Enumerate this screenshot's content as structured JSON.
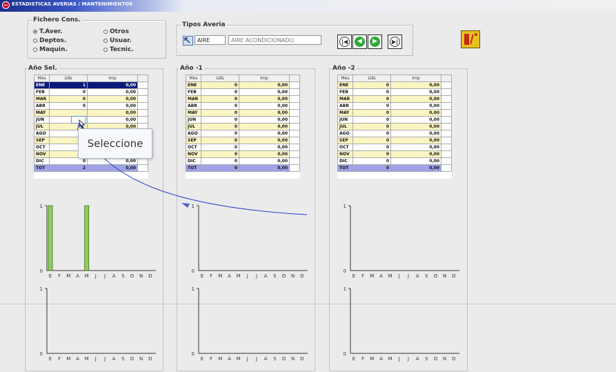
{
  "window": {
    "title": "ESTADISTICAS AVERIAS / MANTENIMIENTOS"
  },
  "fichero": {
    "label": "Fichero Cons.",
    "options": [
      {
        "label": "T.Aver.",
        "selected": true
      },
      {
        "label": "Deptos.",
        "selected": false
      },
      {
        "label": "Maquin.",
        "selected": false
      },
      {
        "label": "Otros",
        "selected": false
      },
      {
        "label": "Usuar.",
        "selected": false
      },
      {
        "label": "Tecnic.",
        "selected": false
      }
    ]
  },
  "tipos": {
    "label": "Tipos Averia",
    "code": "AIRE",
    "description": "AIRE ACONDICIONADO",
    "nav": [
      "first",
      "prev",
      "next",
      "last"
    ]
  },
  "panels": [
    {
      "label": "Año Sel.",
      "headers": [
        "Mes",
        "Uds",
        "Imp"
      ],
      "rows": [
        [
          "ENE",
          "1",
          "0,00"
        ],
        [
          "FEB",
          "0",
          "0,00"
        ],
        [
          "MAR",
          "0",
          "0,00"
        ],
        [
          "ABR",
          "0",
          "0,00"
        ],
        [
          "MAY",
          "",
          "0,00"
        ],
        [
          "JUN",
          "",
          "0,00"
        ],
        [
          "JUL",
          "",
          "0,00"
        ],
        [
          "AGO",
          "",
          "0,00"
        ],
        [
          "SEP",
          "",
          "0,00"
        ],
        [
          "OCT",
          "0",
          "0,00"
        ],
        [
          "NOV",
          "0",
          "0,00"
        ],
        [
          "DIC",
          "0",
          "0,00"
        ],
        [
          "TOT",
          "2",
          "0,00"
        ]
      ]
    },
    {
      "label": "Año -1",
      "headers": [
        "Mes",
        "Uds",
        "Imp"
      ],
      "rows": [
        [
          "ENE",
          "0",
          "0,00"
        ],
        [
          "FEB",
          "0",
          "0,00"
        ],
        [
          "MAR",
          "0",
          "0,00"
        ],
        [
          "ABR",
          "0",
          "0,00"
        ],
        [
          "MAY",
          "0",
          "0,00"
        ],
        [
          "JUN",
          "0",
          "0,00"
        ],
        [
          "JUL",
          "0",
          "0,00"
        ],
        [
          "AGO",
          "0",
          "0,00"
        ],
        [
          "SEP",
          "0",
          "0,00"
        ],
        [
          "OCT",
          "0",
          "0,00"
        ],
        [
          "NOV",
          "0",
          "0,00"
        ],
        [
          "DIC",
          "0",
          "0,00"
        ],
        [
          "TOT",
          "0",
          "0,00"
        ]
      ]
    },
    {
      "label": "Año -2",
      "headers": [
        "Mes",
        "Uds",
        "Imp"
      ],
      "rows": [
        [
          "ENE",
          "0",
          "0,00"
        ],
        [
          "FEB",
          "0",
          "0,00"
        ],
        [
          "MAR",
          "0",
          "0,00"
        ],
        [
          "ABR",
          "0",
          "0,00"
        ],
        [
          "MAY",
          "0",
          "0,00"
        ],
        [
          "JUN",
          "0",
          "0,00"
        ],
        [
          "JUL",
          "0",
          "0,00"
        ],
        [
          "AGO",
          "0",
          "0,00"
        ],
        [
          "SEP",
          "0",
          "0,00"
        ],
        [
          "OCT",
          "0",
          "0,00"
        ],
        [
          "NOV",
          "0",
          "0,00"
        ],
        [
          "DIC",
          "0",
          "0,00"
        ],
        [
          "TOT",
          "0",
          "0,00"
        ]
      ]
    }
  ],
  "chart_data": [
    {
      "type": "bar",
      "panel": "Año Sel.",
      "chart": "top",
      "categories": [
        "E",
        "F",
        "M",
        "A",
        "M",
        "J",
        "J",
        "A",
        "S",
        "O",
        "N",
        "D"
      ],
      "values": [
        1,
        0,
        0,
        0,
        1,
        0,
        0,
        0,
        0,
        0,
        0,
        0
      ],
      "ylim": [
        0,
        1
      ],
      "yticks": [
        "0",
        "1"
      ],
      "bar_color": "#8fce5a"
    },
    {
      "type": "bar",
      "panel": "Año Sel.",
      "chart": "bottom",
      "categories": [
        "E",
        "F",
        "M",
        "A",
        "M",
        "J",
        "J",
        "A",
        "S",
        "O",
        "N",
        "D"
      ],
      "values": [
        0,
        0,
        0,
        0,
        0,
        0,
        0,
        0,
        0,
        0,
        0,
        0
      ],
      "ylim": [
        0,
        1
      ],
      "yticks": [
        "0",
        "1"
      ],
      "bar_color": "#8fce5a"
    },
    {
      "type": "bar",
      "panel": "Año -1",
      "chart": "top",
      "categories": [
        "E",
        "F",
        "M",
        "A",
        "M",
        "J",
        "J",
        "A",
        "S",
        "O",
        "N",
        "D"
      ],
      "values": [
        0,
        0,
        0,
        0,
        0,
        0,
        0,
        0,
        0,
        0,
        0,
        0
      ],
      "ylim": [
        0,
        1
      ],
      "yticks": [
        "0",
        "1"
      ],
      "bar_color": "#8fce5a"
    },
    {
      "type": "bar",
      "panel": "Año -1",
      "chart": "bottom",
      "categories": [
        "E",
        "F",
        "M",
        "A",
        "M",
        "J",
        "J",
        "A",
        "S",
        "O",
        "N",
        "D"
      ],
      "values": [
        0,
        0,
        0,
        0,
        0,
        0,
        0,
        0,
        0,
        0,
        0,
        0
      ],
      "ylim": [
        0,
        1
      ],
      "yticks": [
        "0",
        "1"
      ],
      "bar_color": "#8fce5a"
    },
    {
      "type": "bar",
      "panel": "Año -2",
      "chart": "top",
      "categories": [
        "E",
        "F",
        "M",
        "A",
        "M",
        "J",
        "J",
        "A",
        "S",
        "O",
        "N",
        "D"
      ],
      "values": [
        0,
        0,
        0,
        0,
        0,
        0,
        0,
        0,
        0,
        0,
        0,
        0
      ],
      "ylim": [
        0,
        1
      ],
      "yticks": [
        "0",
        "1"
      ],
      "bar_color": "#8fce5a"
    },
    {
      "type": "bar",
      "panel": "Año -2",
      "chart": "bottom",
      "categories": [
        "E",
        "F",
        "M",
        "A",
        "M",
        "J",
        "J",
        "A",
        "S",
        "O",
        "N",
        "D"
      ],
      "values": [
        0,
        0,
        0,
        0,
        0,
        0,
        0,
        0,
        0,
        0,
        0,
        0
      ],
      "ylim": [
        0,
        1
      ],
      "yticks": [
        "0",
        "1"
      ],
      "bar_color": "#8fce5a"
    }
  ],
  "tooltip": {
    "text": "Seleccione"
  },
  "colors": {
    "accent_bar": "#8fce5a",
    "selected_row": "#0a1a7a",
    "alt_row": "#fbf5c3",
    "total_row": "#9da3e6",
    "annotation": "#2c3acc"
  }
}
